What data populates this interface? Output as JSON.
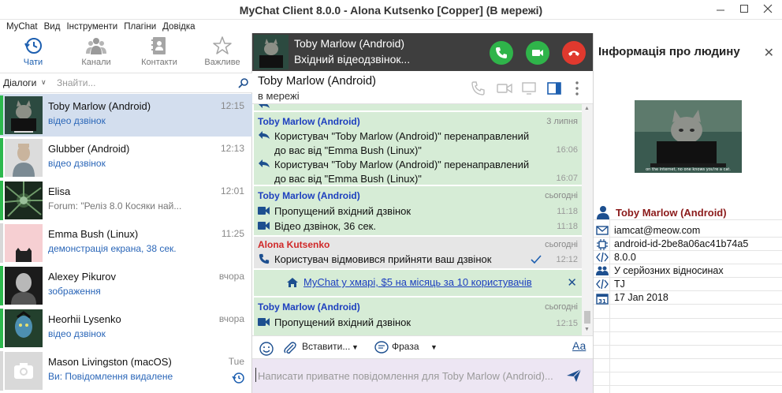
{
  "window": {
    "title": "MyChat Client 8.0.0 - Alona Kutsenko [Copper] (В мережі)"
  },
  "menu": [
    "MyChat",
    "Вид",
    "Інструменти",
    "Плагіни",
    "Довідка"
  ],
  "nav_tabs": [
    {
      "label": "Чати",
      "icon": "history-clock-icon",
      "active": true
    },
    {
      "label": "Канали",
      "icon": "channels-people-icon",
      "active": false
    },
    {
      "label": "Контакти",
      "icon": "contacts-book-icon",
      "active": false
    },
    {
      "label": "Важливе",
      "icon": "star-icon",
      "active": false
    }
  ],
  "filter": {
    "dialogs_label": "Діалоги",
    "search_placeholder": "Знайти..."
  },
  "chats": [
    {
      "name": "Toby Marlow (Android)",
      "subtitle": "відео дзвінок",
      "time": "12:15",
      "selected": true,
      "status_color": "#2db84d"
    },
    {
      "name": "Glubber (Android)",
      "subtitle": "відео дзвінок",
      "time": "12:13",
      "selected": false,
      "status_color": "#2db84d"
    },
    {
      "name": "Elisa",
      "subtitle": "Forum: \"Реліз 8.0   Косяки най...",
      "time": "12:01",
      "selected": false,
      "status_color": "#2db84d"
    },
    {
      "name": "Emma Bush (Linux)",
      "subtitle": "демонстрація екрана, 38 сек.",
      "time": "11:25",
      "selected": false,
      "status_color": "#d8d8d8"
    },
    {
      "name": "Alexey Pikurov",
      "subtitle": "зображення",
      "time": "вчора",
      "selected": false,
      "status_color": "#2db84d"
    },
    {
      "name": "Heorhii Lysenko",
      "subtitle": "відео дзвінок",
      "time": "вчора",
      "selected": false,
      "status_color": "#2db84d"
    },
    {
      "name": "Mason Livingston (macOS)",
      "subtitle": "Ви: Повідомлення видалене",
      "time": "Tue",
      "selected": false,
      "status_color": "#d8d8d8"
    }
  ],
  "call": {
    "name": "Toby Marlow (Android)",
    "status": "Вхідний відеодзвінок...",
    "colors": {
      "accept": "#2fb44a",
      "reject": "#e0392e"
    }
  },
  "chat_header": {
    "name": "Toby Marlow (Android)",
    "status": "в мережі"
  },
  "messages": {
    "block1": {
      "author": "Toby Marlow (Android)",
      "date": "3 липня",
      "lines": [
        {
          "text": "Користувач \"Toby Marlow (Android)\" перенаправлений до вас від \"Emma Bush (Linux)\"",
          "time": "16:06"
        },
        {
          "text": "Користувач \"Toby Marlow (Android)\" перенаправлений до вас від \"Emma Bush (Linux)\"",
          "time": "16:07"
        }
      ]
    },
    "block2": {
      "author": "Toby Marlow (Android)",
      "date": "сьогодні",
      "lines": [
        {
          "text": "Пропущений вхідний дзвінок",
          "time": "11:18"
        },
        {
          "text": "Відео дзвінок, 36 сек.",
          "time": "11:18"
        }
      ]
    },
    "block3": {
      "author": "Alona Kutsenko",
      "date": "сьогодні",
      "lines": [
        {
          "text": "Користувач відмовився прийняти ваш дзвінок",
          "time": "12:12"
        }
      ]
    },
    "promo": "MyChat у хмарі, $5 на місяць за 10 користувачів",
    "block4": {
      "author": "Toby Marlow (Android)",
      "date": "сьогодні",
      "lines": [
        {
          "text": "Пропущений вхідний дзвінок",
          "time": "12:15"
        }
      ]
    }
  },
  "toolbar": {
    "insert_label": "Вставити...",
    "phrase_label": "Фраза",
    "font_label": "Аа"
  },
  "input": {
    "placeholder": "Написати приватне повідомлення для Toby Marlow (Android)..."
  },
  "person_info": {
    "title": "Інформація про людину",
    "name": "Toby Marlow (Android)",
    "photo_caption": "on the internet, no one knows you're a cat.",
    "rows": [
      {
        "icon": "envelope-icon",
        "text": "iamcat@meow.com"
      },
      {
        "icon": "chip-icon",
        "text": "android-id-2be8a06ac41b74a5"
      },
      {
        "icon": "code-icon",
        "text": "8.0.0"
      },
      {
        "icon": "people-icon",
        "text": "У серйозних відносинах"
      },
      {
        "icon": "code-icon",
        "text": "TJ"
      },
      {
        "icon": "calendar-icon",
        "text": "17 Jan 2018"
      }
    ]
  }
}
